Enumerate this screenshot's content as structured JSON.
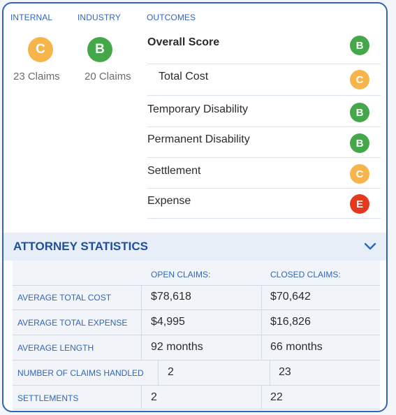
{
  "columns": {
    "internal": "INTERNAL",
    "industry": "INDUSTRY",
    "outcomes": "OUTCOMES"
  },
  "internal": {
    "grade": "C",
    "claims": "23 Claims"
  },
  "industry": {
    "grade": "B",
    "claims": "20 Claims"
  },
  "outcomes": [
    {
      "label": "Overall Score",
      "grade": "B"
    },
    {
      "label": "Total Cost",
      "grade": "C"
    },
    {
      "label": "Temporary Disability",
      "grade": "B"
    },
    {
      "label": "Permanent Disability",
      "grade": "B"
    },
    {
      "label": "Settlement",
      "grade": "C"
    },
    {
      "label": "Expense",
      "grade": "E"
    }
  ],
  "grade_colors": {
    "B": "#44a84a",
    "C": "#f6b44b",
    "E": "#e33a1e"
  },
  "attorney_statistics": {
    "title": "ATTORNEY STATISTICS",
    "headers": {
      "open": "OPEN CLAIMS:",
      "closed": "CLOSED CLAIMS:"
    },
    "rows": [
      {
        "label": "AVERAGE TOTAL COST",
        "open": "$78,618",
        "closed": "$70,642"
      },
      {
        "label": "AVERAGE TOTAL EXPENSE",
        "open": "$4,995",
        "closed": "$16,826"
      },
      {
        "label": "AVERAGE LENGTH",
        "open": "92 months",
        "closed": "66 months"
      },
      {
        "label": "NUMBER OF CLAIMS HANDLED",
        "open": "2",
        "closed": "23"
      },
      {
        "label": "SETTLEMENTS",
        "open": "2",
        "closed": "22"
      }
    ]
  }
}
